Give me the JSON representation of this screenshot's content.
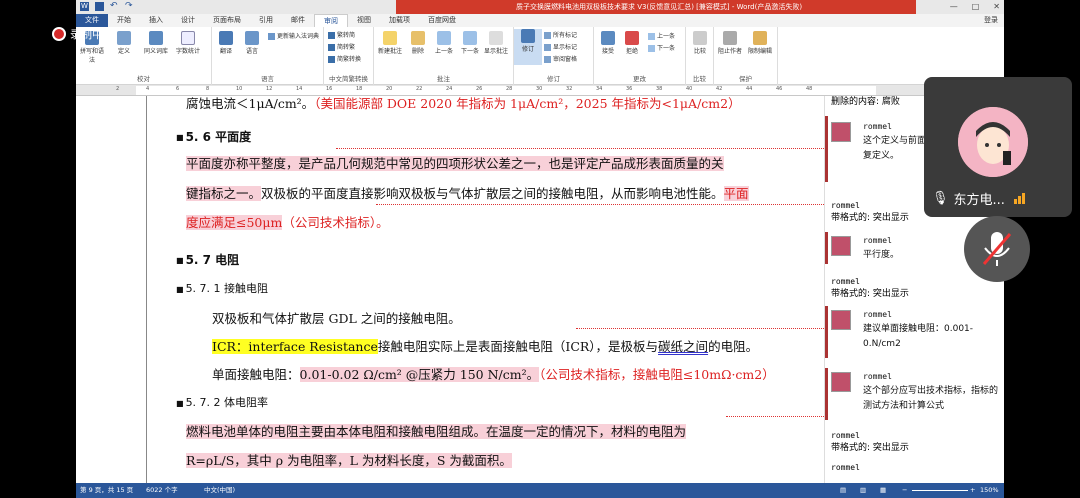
{
  "window": {
    "title": "质子交换膜燃料电池用双极板技术要求 V3(反馈意见汇总) [兼容模式] - Word(产品激活失败)",
    "minimize": "—",
    "restore": "□",
    "close": "✕"
  },
  "ribbon_tabs": [
    "文件",
    "开始",
    "插入",
    "设计",
    "页面布局",
    "引用",
    "邮件",
    "审阅",
    "视图",
    "加载项",
    "百度网盘"
  ],
  "active_tab": "审阅",
  "login_label": "登录",
  "ribbon": {
    "groups": [
      {
        "title": "校对",
        "buttons": [
          "拼写和语法",
          "定义",
          "同义词库",
          "字数统计"
        ]
      },
      {
        "title": "语言",
        "buttons": [
          "翻译",
          "语言",
          "更新输入法词典"
        ]
      },
      {
        "title": "中文简繁转换",
        "buttons": [
          "繁转简",
          "简转繁",
          "简繁转换"
        ]
      },
      {
        "title": "批注",
        "buttons": [
          "新建批注",
          "删除",
          "上一条",
          "下一条",
          "显示批注"
        ]
      },
      {
        "title": "修订",
        "buttons": [
          "修订",
          "所有标记",
          "显示标记",
          "审阅窗格"
        ]
      },
      {
        "title": "更改",
        "buttons": [
          "接受",
          "拒绝",
          "上一条",
          "下一条"
        ]
      },
      {
        "title": "比较",
        "buttons": [
          "比较"
        ]
      },
      {
        "title": "保护",
        "buttons": [
          "阻止作者",
          "限制编辑"
        ]
      }
    ]
  },
  "ruler_numbers": [
    "2",
    "4",
    "6",
    "8",
    "10",
    "12",
    "14",
    "16",
    "18",
    "20",
    "22",
    "24",
    "26",
    "28",
    "30",
    "32",
    "34",
    "36",
    "38",
    "40",
    "42",
    "44",
    "46",
    "48"
  ],
  "recording_label": "录制中",
  "document": {
    "top_line_plain": "腐蚀电流＜1μA/cm²。",
    "top_line_red": "（美国能源部 DOE 2020 年指标为 1μA/cm²，2025 年指标为<1μA/cm2）",
    "h56": "5. 6 平面度",
    "p56_a": "平面度亦称平整度，是产品几何规范中常见的四项形状公差之一，也是评定产品成形表面质量的关",
    "p56_b1": "键指标之一。",
    "p56_b2": "双极板的平面度直接影响双极板与气体扩散层之间的接触电阻，从而影响电池性能。",
    "p56_b3": "平面",
    "p56_c1": "度应满足≤50μm",
    "p56_c2": "（公司技术指标）。",
    "h57": "5. 7 电阻",
    "h571": "5. 7. 1  接触电阻",
    "p571_a": "双极板和气体扩散层 GDL 之间的接触电阻。",
    "p571_b1": "ICR：interface Resistance",
    "p571_b2": "接触电阻实际上是表面接触电阻（ICR），是极板与",
    "p571_b3": "碳纸之间",
    "p571_b4": "的电阻。",
    "p571_c1": "单面接触电阻：",
    "p571_c2": "0.01-0.02 Ω/cm² @压紧力 150 N/cm²。",
    "p571_c3": "（公司技术指标，接触电阻≤10mΩ·cm2）",
    "h572": "5. 7. 2  体电阻率",
    "p572_a": "燃料电池单体的电阻主要由本体电阻和接触电阻组成。在温度一定的情况下，材料的电阻为",
    "p572_b": "R=ρL/S，其中 ρ 为电阻率，L 为材料长度，S 为截面积。"
  },
  "comments": {
    "top_text": "删除的内容: 腐败",
    "c1": {
      "author": "rommel",
      "text": "这个定义与前面那个最终定义处重复定义。"
    },
    "f1": {
      "author": "rommel",
      "label": "带格式的: 突出显示"
    },
    "c2": {
      "author": "rommel",
      "text": "平行度。"
    },
    "f2": {
      "author": "rommel",
      "label": "带格式的: 突出显示"
    },
    "c3": {
      "author": "rommel",
      "text": "建议单面接触电阻：0.001-0.N/cm2"
    },
    "c4": {
      "author": "rommel",
      "text": "这个部分应写出技术指标，指标的测试方法和计算公式"
    },
    "f3": {
      "author": "rommel",
      "label": "带格式的: 突出显示"
    },
    "c5": {
      "author": "rommel"
    }
  },
  "status": {
    "page": "第 9 页，共 15 页",
    "words": "6022 个字",
    "lang": "中文(中国)",
    "zoom": "150%"
  },
  "video": {
    "name": "东方电..."
  },
  "colors": {
    "word_blue": "#2b579a",
    "title_red": "#d03a2a",
    "revision_red": "#d22222",
    "highlight_pink": "#f8d0d8",
    "highlight_yellow": "#ffff22"
  }
}
